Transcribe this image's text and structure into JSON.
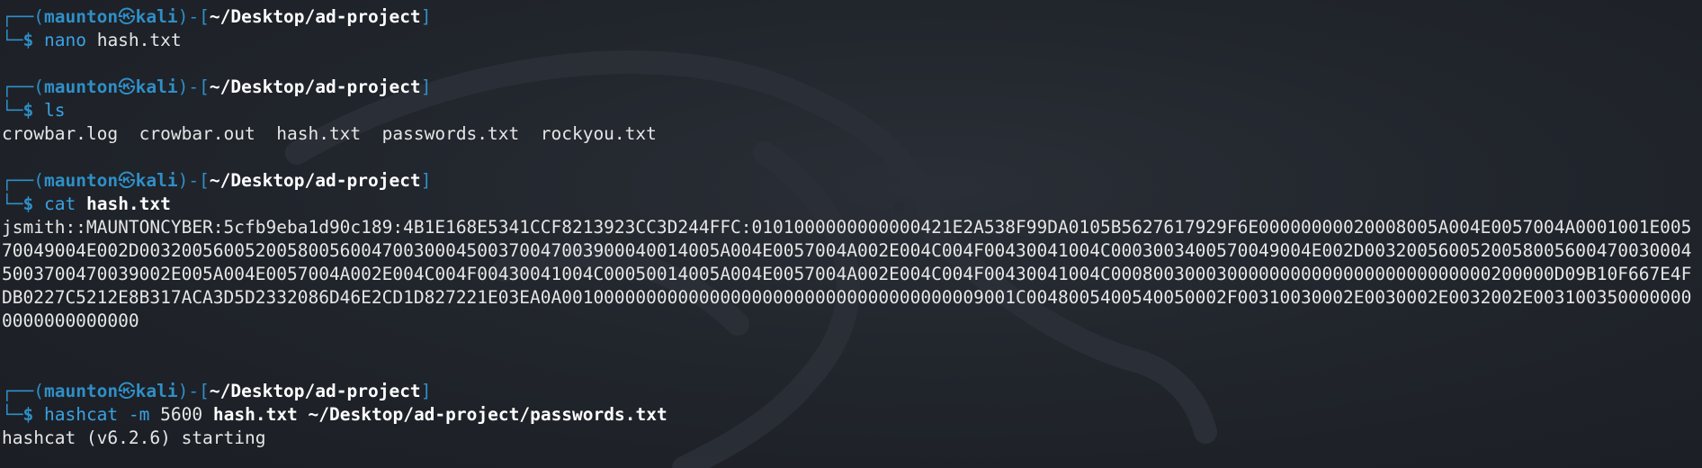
{
  "prompt": {
    "user": "maunton",
    "at_symbol": "㉿",
    "host": "kali",
    "cwd": "~/Desktop/ad-project",
    "top_prefix": "┌──(",
    "mid_sep": ")-[",
    "top_suffix": "]",
    "bottom_prefix": "└─",
    "dollar": "$"
  },
  "blocks": [
    {
      "command": "nano",
      "args": [
        {
          "text": "hash.txt",
          "style": "arg"
        }
      ],
      "output": []
    },
    {
      "command": "ls",
      "args": [],
      "output": [
        "crowbar.log  crowbar.out  hash.txt  passwords.txt  rockyou.txt"
      ]
    },
    {
      "command": "cat",
      "args": [
        {
          "text": "hash.txt",
          "style": "argbold"
        }
      ],
      "output": [
        "jsmith::MAUNTONCYBER:5cfb9eba1d90c189:4B1E168E5341CCF8213923CC3D244FFC:0101000000000000421E2A538F99DA0105B5627617929F6E00000000020008005A004E0057004A0001001E00570049004E002D003200560052005800560047003000450037004700390004001400 5A004E0057004A002E004C004F00430041004C0003003400570049004E002D003200560052005800560047003000450037004700390 02E005A004E0057004A002E004C004F00430041004C00050014005A004E0057004A002E004C004F00430041004C000800300030000000000000000000000000200000D09B10F667E4FDB0227C5212E8B317ACA3D5D2332086D46E2CD1D827221E03EA0A001000000000000000000000000000000000000900 1C0048005400540050002F00310030002E0030002E0032002E0031003500000000000000000000"
      ],
      "trailing_blanks": 2
    },
    {
      "command": "hashcat",
      "args": [
        {
          "text": "-m",
          "style": "opt"
        },
        {
          "text": "5600",
          "style": "num"
        },
        {
          "text": "hash.txt",
          "style": "argbold"
        },
        {
          "text": "~/Desktop/ad-project/passwords.txt",
          "style": "argbold"
        }
      ],
      "output": [
        "hashcat (v6.2.6) starting"
      ]
    }
  ],
  "colors": {
    "background": "#1f232a",
    "prompt_blue": "#2f8fc7",
    "command_blue": "#3aa3e3",
    "text": "#e6e6e6"
  }
}
